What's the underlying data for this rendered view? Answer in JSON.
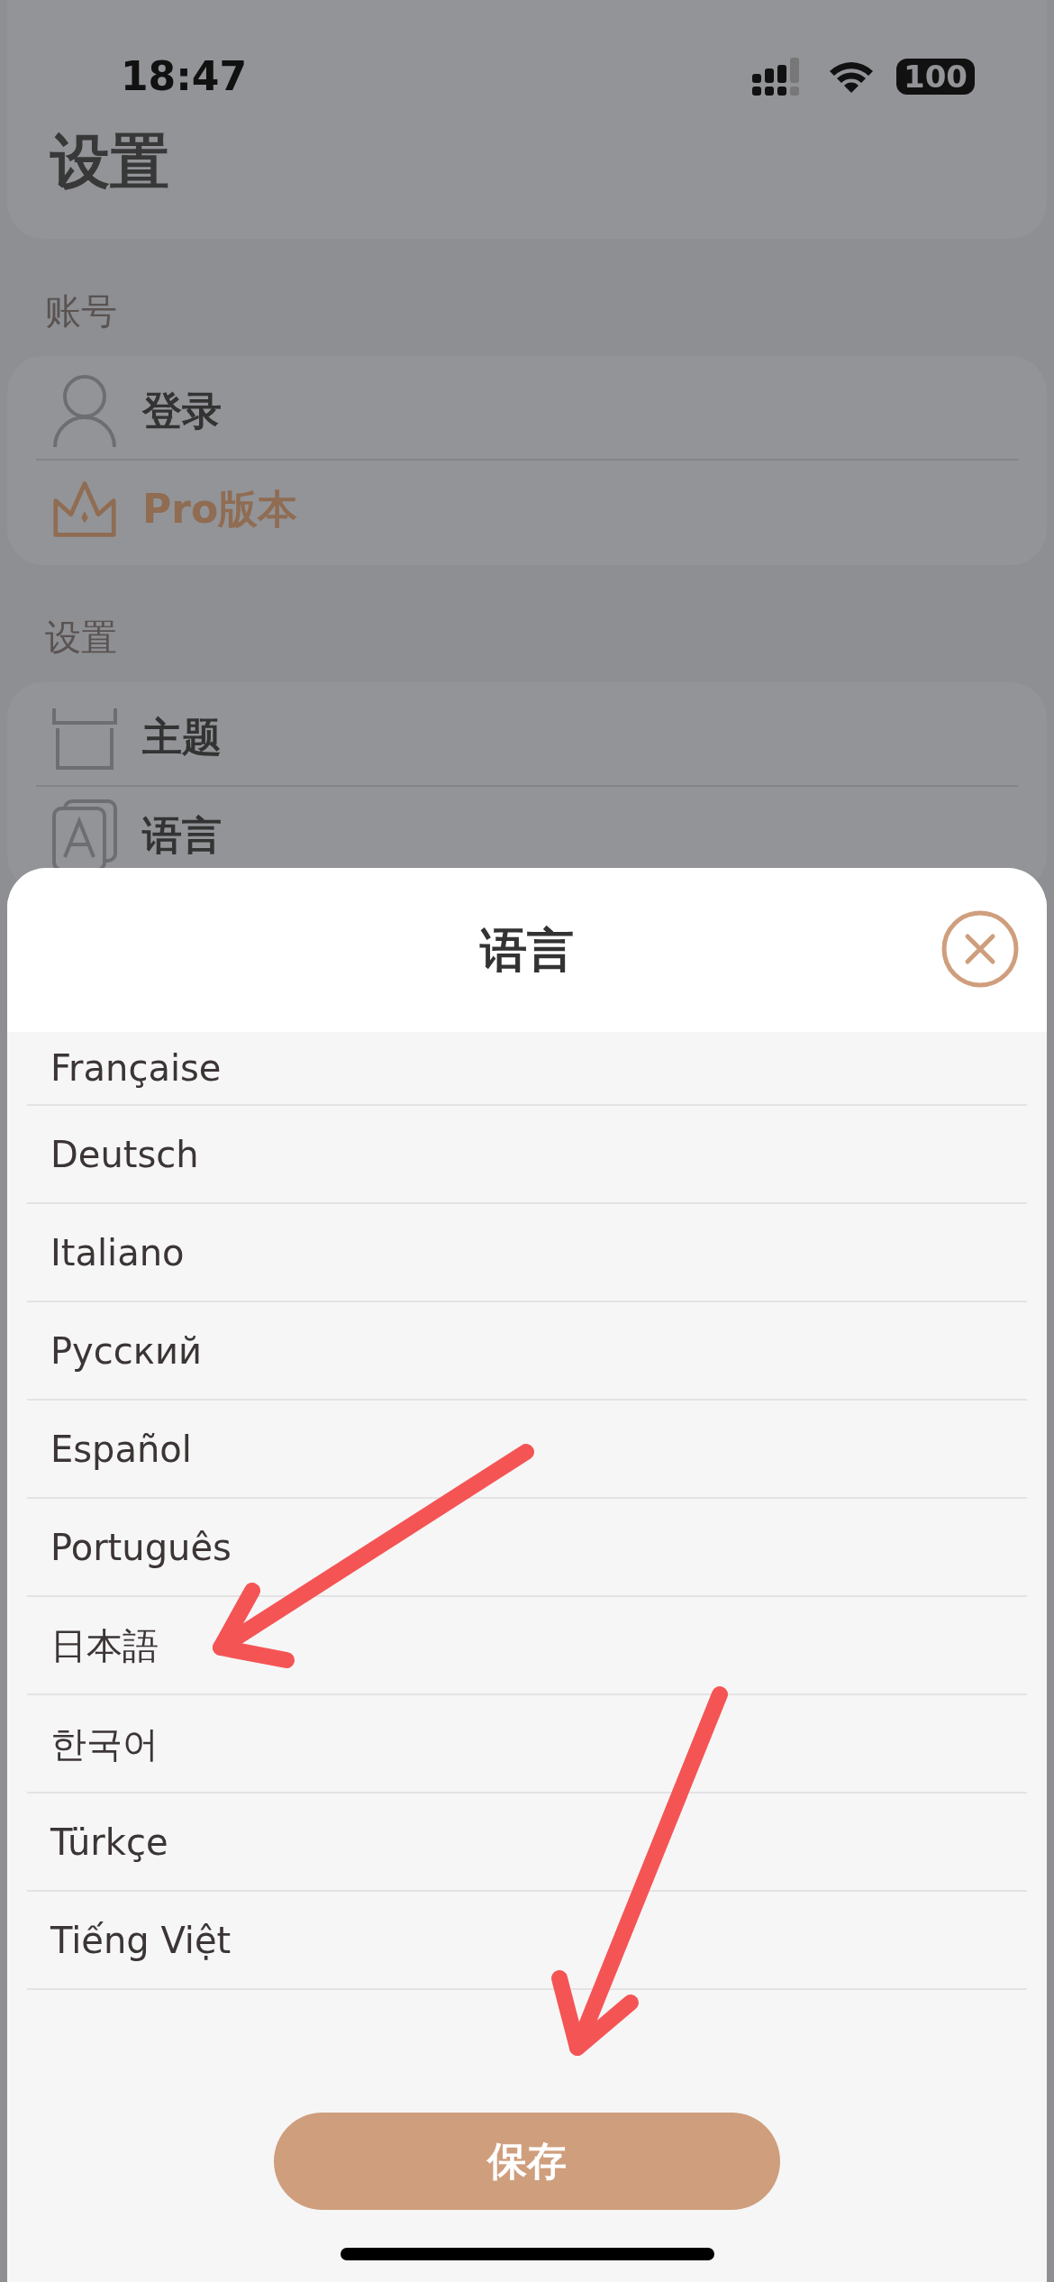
{
  "status_bar": {
    "time": "18:47",
    "battery": "100"
  },
  "page_title": "设置",
  "sections": [
    {
      "header": "账号",
      "items": [
        {
          "label": "登录",
          "kind": "person",
          "accent": false
        },
        {
          "label": "Pro版本",
          "kind": "crown",
          "accent": true
        }
      ]
    },
    {
      "header": "设置",
      "items": [
        {
          "label": "主题",
          "kind": "theme",
          "accent": false
        },
        {
          "label": "语言",
          "kind": "language",
          "accent": false
        }
      ]
    }
  ],
  "sheet": {
    "title": "语言",
    "languages": [
      "Française",
      "Deutsch",
      "Italiano",
      "Русский",
      "Español",
      "Português",
      "日本語",
      "한국어",
      "Türkçe",
      "Tiếng Việt"
    ],
    "save_button": "保存"
  }
}
